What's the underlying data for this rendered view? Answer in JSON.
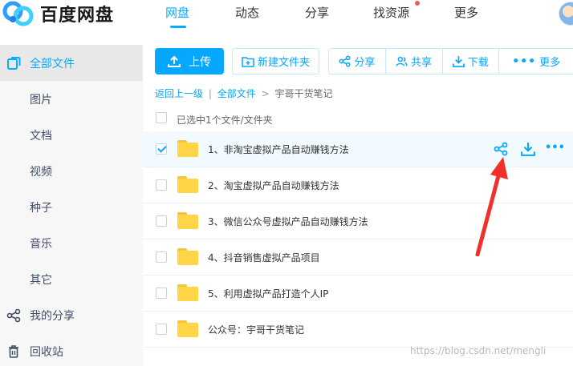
{
  "app": {
    "logo_text": "百度网盘",
    "brand_color": "#09AAFF"
  },
  "nav": {
    "items": [
      {
        "label": "网盘",
        "active": true
      },
      {
        "label": "动态"
      },
      {
        "label": "分享"
      },
      {
        "label": "找资源",
        "has_dot": true
      },
      {
        "label": "更多"
      }
    ]
  },
  "sidebar": {
    "items": [
      {
        "label": "全部文件",
        "icon": "all-files-icon",
        "active": true
      },
      {
        "label": "图片"
      },
      {
        "label": "文档"
      },
      {
        "label": "视频"
      },
      {
        "label": "种子"
      },
      {
        "label": "音乐"
      },
      {
        "label": "其它"
      },
      {
        "label": "我的分享",
        "icon": "share-icon"
      },
      {
        "label": "回收站",
        "icon": "trash-icon"
      }
    ]
  },
  "toolbar": {
    "upload_label": "上传",
    "new_folder_label": "新建文件夹",
    "share_label": "分享",
    "co_share_label": "共享",
    "download_label": "下载",
    "more_label": "更多"
  },
  "breadcrumb": {
    "back": "返回上一级",
    "divider": "|",
    "root": "全部文件",
    "arrow": ">",
    "current": "宇哥干货笔记"
  },
  "selection": {
    "info": "已选中1个文件/文件夹"
  },
  "files": [
    {
      "name": "1、非淘宝虚拟产品自动赚钱方法",
      "selected": true
    },
    {
      "name": "2、淘宝虚拟产品自动赚钱方法",
      "selected": false
    },
    {
      "name": "3、微信公众号虚拟产品自动赚钱方法",
      "selected": false
    },
    {
      "name": "4、抖音销售虚拟产品项目",
      "selected": false
    },
    {
      "name": "5、利用虚拟产品打造个人IP",
      "selected": false
    },
    {
      "name": "公众号：宇哥干货笔记",
      "selected": false
    }
  ],
  "watermark": "https://blog.csdn.net/mengli"
}
